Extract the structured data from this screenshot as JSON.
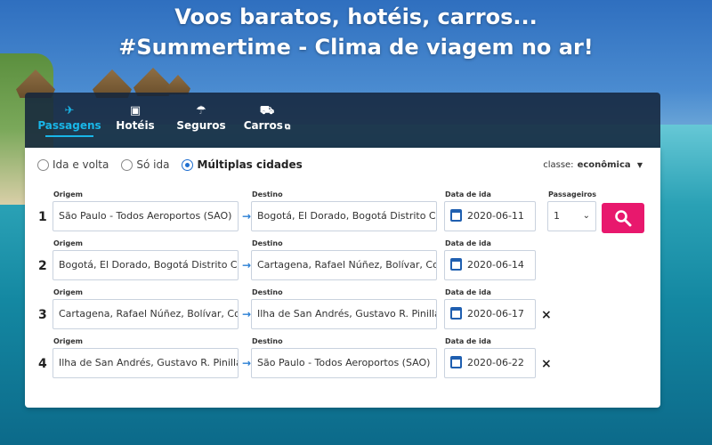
{
  "headline": {
    "line1": "Voos baratos, hotéis, carros...",
    "line2": "#Summertime - Clima de viagem no ar!"
  },
  "tabs": [
    {
      "label": "Passagens",
      "icon": "plane-icon",
      "active": true
    },
    {
      "label": "Hotéis",
      "icon": "hotel-icon",
      "active": false
    },
    {
      "label": "Seguros",
      "icon": "umbrella-icon",
      "active": false
    },
    {
      "label": "Carros",
      "icon": "car-icon",
      "active": false,
      "external_icon": "⧉"
    }
  ],
  "trip_types": [
    {
      "label": "Ida e volta",
      "selected": false
    },
    {
      "label": "Só ida",
      "selected": false
    },
    {
      "label": "Múltiplas cidades",
      "selected": true
    }
  ],
  "cabin": {
    "label": "classe:",
    "value": "econômica",
    "arrow": "▼"
  },
  "labels": {
    "origin": "Origem",
    "destination": "Destino",
    "date": "Data de ida",
    "passengers": "Passageiros"
  },
  "legs": [
    {
      "number": "1",
      "origin": "São Paulo - Todos Aeroportos (SAO)",
      "destination": "Bogotá, El Dorado, Bogotá Distrito Capital, Co",
      "date": "2020-06-11"
    },
    {
      "number": "2",
      "origin": "Bogotá, El Dorado, Bogotá Distrito Capital, Co",
      "destination": "Cartagena, Rafael Núñez, Bolívar, Colômbia",
      "date": "2020-06-14"
    },
    {
      "number": "3",
      "origin": "Cartagena, Rafael Núñez, Bolívar, Colômbia",
      "destination": "Ilha de San Andrés, Gustavo R. Pinilla Int, Sa",
      "date": "2020-06-17"
    },
    {
      "number": "4",
      "origin": "Ilha de San Andrés, Gustavo R. Pinilla Int, Sa",
      "destination": "São Paulo - Todos Aeroportos (SAO)",
      "date": "2020-06-22"
    }
  ],
  "passengers": {
    "value": "1",
    "arrow": "⌄"
  },
  "arrow_symbol": "→",
  "remove_symbol": "×",
  "colors": {
    "accent": "#19b6e8",
    "search": "#e8186d"
  }
}
